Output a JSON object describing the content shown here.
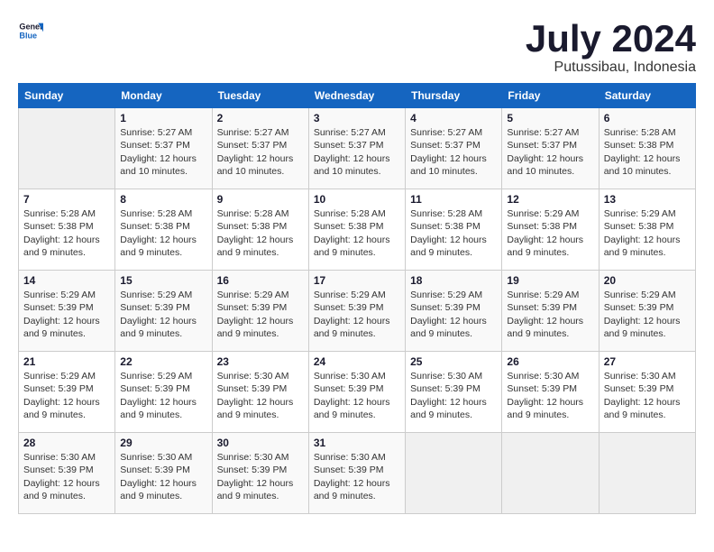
{
  "header": {
    "logo_general": "General",
    "logo_blue": "Blue",
    "month_title": "July 2024",
    "subtitle": "Putussibau, Indonesia"
  },
  "days_of_week": [
    "Sunday",
    "Monday",
    "Tuesday",
    "Wednesday",
    "Thursday",
    "Friday",
    "Saturday"
  ],
  "weeks": [
    [
      {
        "day": "",
        "empty": true
      },
      {
        "day": "1",
        "sunrise": "5:27 AM",
        "sunset": "5:37 PM",
        "daylight": "12 hours and 10 minutes."
      },
      {
        "day": "2",
        "sunrise": "5:27 AM",
        "sunset": "5:37 PM",
        "daylight": "12 hours and 10 minutes."
      },
      {
        "day": "3",
        "sunrise": "5:27 AM",
        "sunset": "5:37 PM",
        "daylight": "12 hours and 10 minutes."
      },
      {
        "day": "4",
        "sunrise": "5:27 AM",
        "sunset": "5:37 PM",
        "daylight": "12 hours and 10 minutes."
      },
      {
        "day": "5",
        "sunrise": "5:27 AM",
        "sunset": "5:37 PM",
        "daylight": "12 hours and 10 minutes."
      },
      {
        "day": "6",
        "sunrise": "5:28 AM",
        "sunset": "5:38 PM",
        "daylight": "12 hours and 10 minutes."
      }
    ],
    [
      {
        "day": "7",
        "sunrise": "5:28 AM",
        "sunset": "5:38 PM",
        "daylight": "12 hours and 9 minutes."
      },
      {
        "day": "8",
        "sunrise": "5:28 AM",
        "sunset": "5:38 PM",
        "daylight": "12 hours and 9 minutes."
      },
      {
        "day": "9",
        "sunrise": "5:28 AM",
        "sunset": "5:38 PM",
        "daylight": "12 hours and 9 minutes."
      },
      {
        "day": "10",
        "sunrise": "5:28 AM",
        "sunset": "5:38 PM",
        "daylight": "12 hours and 9 minutes."
      },
      {
        "day": "11",
        "sunrise": "5:28 AM",
        "sunset": "5:38 PM",
        "daylight": "12 hours and 9 minutes."
      },
      {
        "day": "12",
        "sunrise": "5:29 AM",
        "sunset": "5:38 PM",
        "daylight": "12 hours and 9 minutes."
      },
      {
        "day": "13",
        "sunrise": "5:29 AM",
        "sunset": "5:38 PM",
        "daylight": "12 hours and 9 minutes."
      }
    ],
    [
      {
        "day": "14",
        "sunrise": "5:29 AM",
        "sunset": "5:39 PM",
        "daylight": "12 hours and 9 minutes."
      },
      {
        "day": "15",
        "sunrise": "5:29 AM",
        "sunset": "5:39 PM",
        "daylight": "12 hours and 9 minutes."
      },
      {
        "day": "16",
        "sunrise": "5:29 AM",
        "sunset": "5:39 PM",
        "daylight": "12 hours and 9 minutes."
      },
      {
        "day": "17",
        "sunrise": "5:29 AM",
        "sunset": "5:39 PM",
        "daylight": "12 hours and 9 minutes."
      },
      {
        "day": "18",
        "sunrise": "5:29 AM",
        "sunset": "5:39 PM",
        "daylight": "12 hours and 9 minutes."
      },
      {
        "day": "19",
        "sunrise": "5:29 AM",
        "sunset": "5:39 PM",
        "daylight": "12 hours and 9 minutes."
      },
      {
        "day": "20",
        "sunrise": "5:29 AM",
        "sunset": "5:39 PM",
        "daylight": "12 hours and 9 minutes."
      }
    ],
    [
      {
        "day": "21",
        "sunrise": "5:29 AM",
        "sunset": "5:39 PM",
        "daylight": "12 hours and 9 minutes."
      },
      {
        "day": "22",
        "sunrise": "5:29 AM",
        "sunset": "5:39 PM",
        "daylight": "12 hours and 9 minutes."
      },
      {
        "day": "23",
        "sunrise": "5:30 AM",
        "sunset": "5:39 PM",
        "daylight": "12 hours and 9 minutes."
      },
      {
        "day": "24",
        "sunrise": "5:30 AM",
        "sunset": "5:39 PM",
        "daylight": "12 hours and 9 minutes."
      },
      {
        "day": "25",
        "sunrise": "5:30 AM",
        "sunset": "5:39 PM",
        "daylight": "12 hours and 9 minutes."
      },
      {
        "day": "26",
        "sunrise": "5:30 AM",
        "sunset": "5:39 PM",
        "daylight": "12 hours and 9 minutes."
      },
      {
        "day": "27",
        "sunrise": "5:30 AM",
        "sunset": "5:39 PM",
        "daylight": "12 hours and 9 minutes."
      }
    ],
    [
      {
        "day": "28",
        "sunrise": "5:30 AM",
        "sunset": "5:39 PM",
        "daylight": "12 hours and 9 minutes."
      },
      {
        "day": "29",
        "sunrise": "5:30 AM",
        "sunset": "5:39 PM",
        "daylight": "12 hours and 9 minutes."
      },
      {
        "day": "30",
        "sunrise": "5:30 AM",
        "sunset": "5:39 PM",
        "daylight": "12 hours and 9 minutes."
      },
      {
        "day": "31",
        "sunrise": "5:30 AM",
        "sunset": "5:39 PM",
        "daylight": "12 hours and 9 minutes."
      },
      {
        "day": "",
        "empty": true
      },
      {
        "day": "",
        "empty": true
      },
      {
        "day": "",
        "empty": true
      }
    ]
  ]
}
